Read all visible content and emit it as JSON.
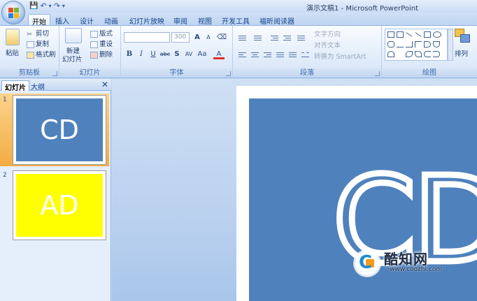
{
  "window": {
    "title": "演示文稿1 - Microsoft PowerPoint"
  },
  "qat": {
    "save": "💾",
    "undo": "↶",
    "undo_arrow": "▾",
    "redo": "↷",
    "customize": "▾"
  },
  "tabs": [
    "开始",
    "插入",
    "设计",
    "动画",
    "幻灯片放映",
    "审阅",
    "视图",
    "开发工具",
    "福昕阅读器"
  ],
  "ribbon": {
    "clipboard": {
      "paste": "粘贴",
      "cut": "剪切",
      "copy": "复制",
      "format_painter": "格式刷",
      "label": "剪贴板"
    },
    "slides": {
      "new_slide_1": "新建",
      "new_slide_2": "幻灯片",
      "layout": "版式",
      "reset": "重设",
      "delete": "删除",
      "label": "幻灯片"
    },
    "font": {
      "name": "",
      "size": "300",
      "grow": "A",
      "shrink": "A",
      "bold": "B",
      "italic": "I",
      "underline": "U",
      "strike": "abc",
      "shadow": "S",
      "spacing": "AV",
      "case": "Aa",
      "color": "A",
      "label": "字体"
    },
    "paragraph": {
      "text_direction": "文字方向",
      "align_text": "对齐文本",
      "smartart": "转换为 SmartArt",
      "label": "段落"
    },
    "drawing": {
      "arrange": "排列",
      "label": "绘图"
    }
  },
  "panel": {
    "tabs": [
      "幻灯片",
      "大纲"
    ],
    "close": "✕",
    "slides": [
      {
        "num": "1",
        "text": "CD",
        "bg": "#4f81bd"
      },
      {
        "num": "2",
        "text": "AD",
        "bg": "#ffff00"
      }
    ]
  },
  "slide": {
    "text": "CD",
    "bg": "#4f81bd"
  },
  "watermark": {
    "c": "C",
    "name": "酷知网",
    "url": "www.coozhi.com"
  }
}
